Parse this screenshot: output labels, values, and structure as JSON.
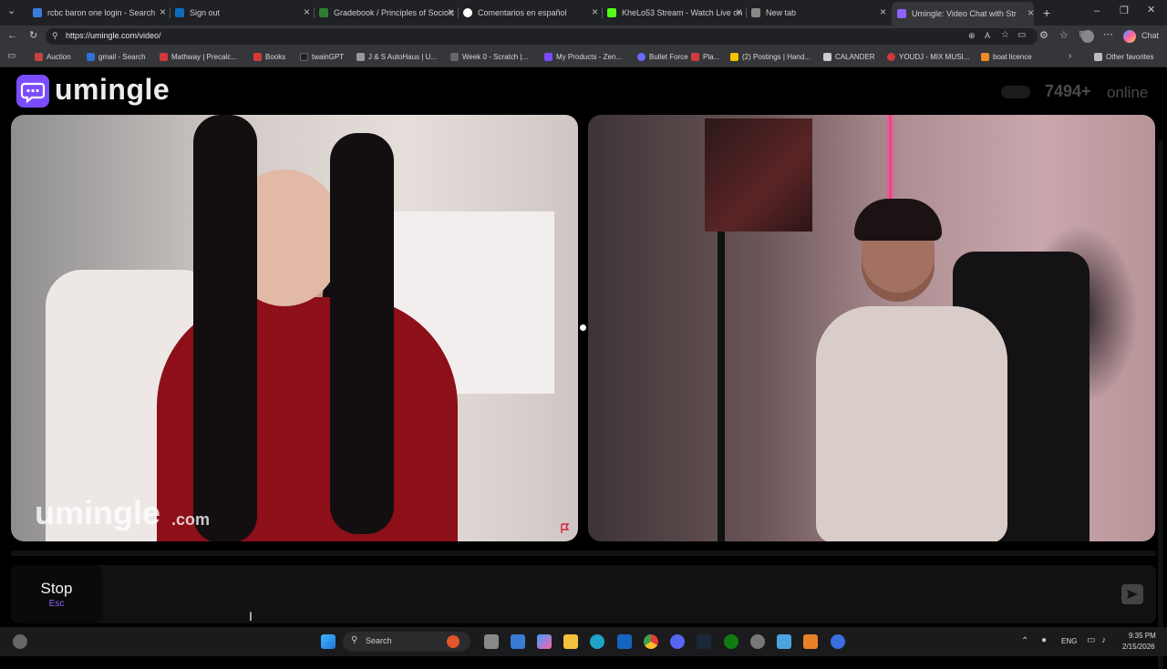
{
  "browser": {
    "tabs": [
      {
        "title": "rcbc baron one login - Search",
        "color": "#3b7ddd"
      },
      {
        "title": "Sign out",
        "color": "#0f6cbd"
      },
      {
        "title": "Gradebook / Principles of Sociolo",
        "color": "#2e7d32"
      },
      {
        "title": "Comentarios en español",
        "color": "#ffffff"
      },
      {
        "title": "KheLo53 Stream - Watch Live on K",
        "color": "#53fc18"
      },
      {
        "title": "New tab",
        "color": "#888888"
      },
      {
        "title": "Umingle: Video Chat with Str",
        "color": "#8f63ff"
      }
    ],
    "url": "https://umingle.com/video/",
    "chat_button_label": "Chat",
    "bookmarks": [
      {
        "label": "Auction",
        "color": "#c94040"
      },
      {
        "label": "gmail - Search",
        "color": "#2f6fd6"
      },
      {
        "label": "Mathway | Precalc...",
        "color": "#d23a3a"
      },
      {
        "label": "Books",
        "color": "#d23a3a"
      },
      {
        "label": "twainGPT",
        "color": "#222222"
      },
      {
        "label": "J & S AutoHaus | U...",
        "color": "#999999"
      },
      {
        "label": "Week 0 - Scratch |...",
        "color": "#666666"
      },
      {
        "label": "My Products - Zen...",
        "color": "#7b4cff"
      },
      {
        "label": "Bullet Force",
        "color": "#6b6bff"
      },
      {
        "label": "Pla...",
        "color": "#d23a3a"
      },
      {
        "label": "(2) Postings | Hand...",
        "color": "#f5c400"
      },
      {
        "label": "CALANDER",
        "color": "#cccccc"
      },
      {
        "label": "YOUDJ - MIX MUSI...",
        "color": "#d23a3a"
      },
      {
        "label": "boat licence",
        "color": "#f08a24"
      }
    ],
    "other_favorites": "Other favorites"
  },
  "page": {
    "logo_text": "umingle",
    "online_count": "7494+",
    "online_label": "online",
    "watermark_main": "umingle",
    "watermark_suffix": ".com",
    "stop_label": "Stop",
    "stop_hint": "Esc",
    "chat_input_placeholder": "",
    "accent_color": "#7b4cff"
  },
  "taskbar": {
    "search_label": "Search",
    "language": "ENG",
    "time": "9:35 PM",
    "date": "2/15/2026"
  }
}
